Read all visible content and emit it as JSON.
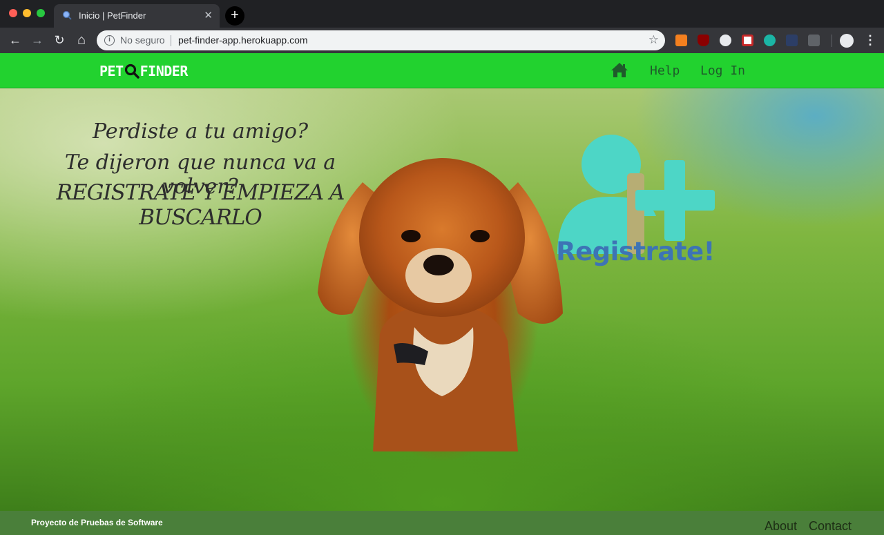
{
  "browser": {
    "tab_title": "Inicio | PetFinder",
    "tab_close": "✕",
    "new_tab": "+",
    "security_label": "No seguro",
    "url": "pet-finder-app.herokuapp.com",
    "bookmark_star": "☆",
    "menu": "⋮",
    "back": "←",
    "forward": "→",
    "reload": "↻",
    "home": "⌂",
    "info": "i"
  },
  "navbar": {
    "logo_left": "PET",
    "logo_right": "FINDER",
    "links": [
      "Help",
      "Log In"
    ],
    "home_icon": "home-icon",
    "color": "#22d22f"
  },
  "hero": {
    "lines": [
      "Perdiste a tu amigo?",
      "Te dijeron que nunca va a volver?",
      "REGISTRATE Y EMPIEZA A BUSCARLO"
    ],
    "register_label": "Registrate!",
    "register_icon": "add-user-icon",
    "accent": "#4dd6c6",
    "label_color": "#3d74b5"
  },
  "footer": {
    "text": "Proyecto de Pruebas de Software",
    "links": [
      "About",
      "Contact"
    ],
    "color": "#4a7f3a"
  }
}
